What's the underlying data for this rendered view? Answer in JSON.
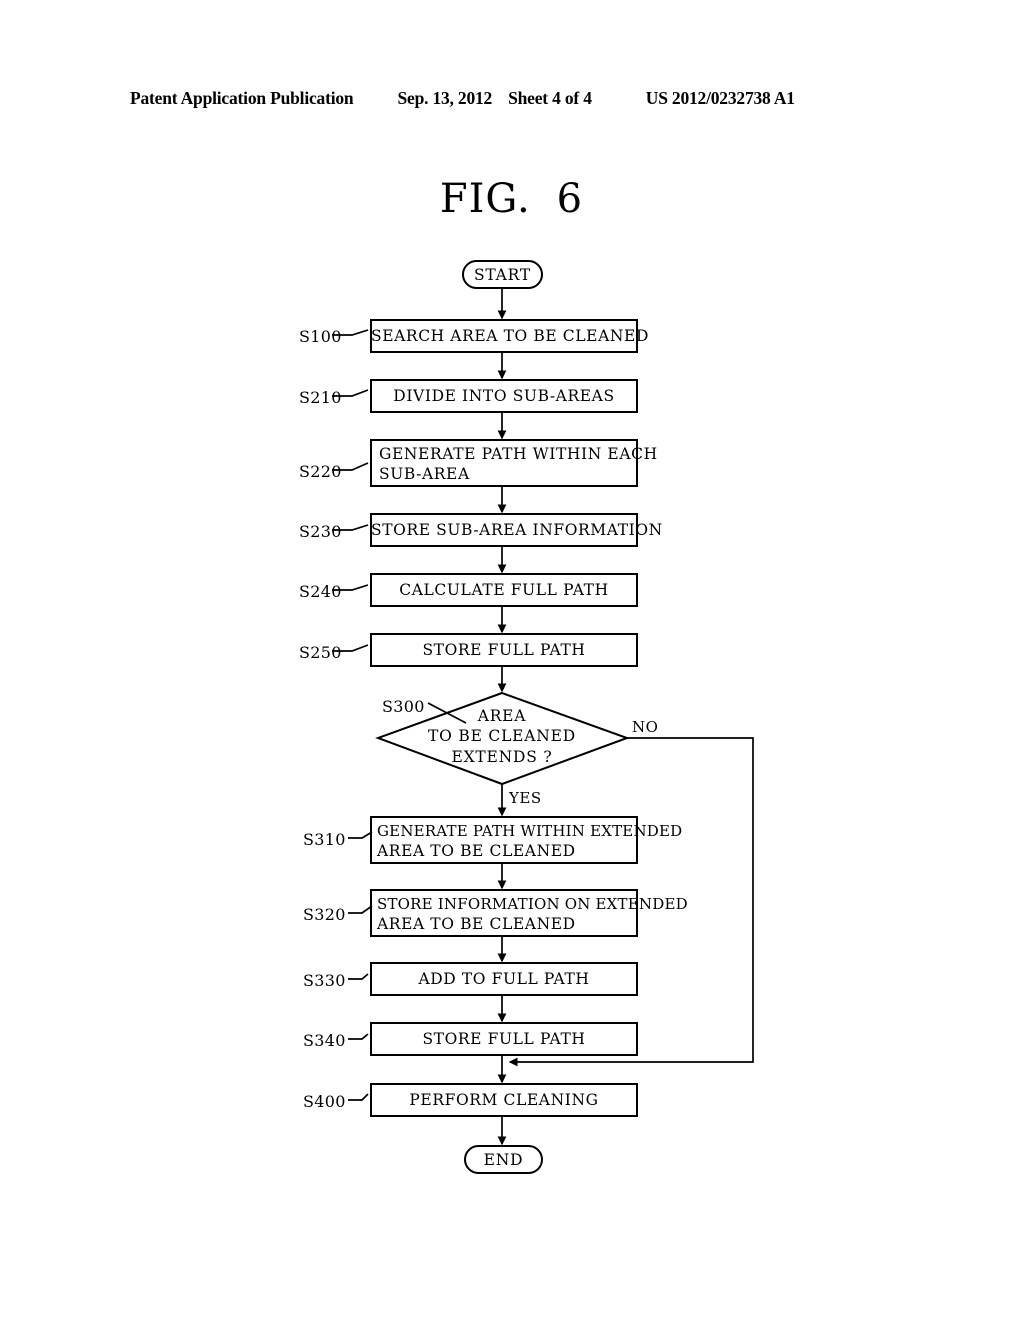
{
  "header": {
    "publication": "Patent Application Publication",
    "date": "Sep. 13, 2012",
    "sheet": "Sheet 4 of 4",
    "document_number": "US 2012/0232738 A1"
  },
  "figure": {
    "label": "FIG.",
    "number": "6"
  },
  "colors": {
    "ink": "#000000",
    "page": "#ffffff"
  },
  "flowchart": {
    "start_label": "START",
    "end_label": "END",
    "branch_yes": "YES",
    "branch_no": "NO",
    "decision": {
      "ref": "S300",
      "line1": "AREA",
      "line2": "TO BE CLEANED",
      "line3": "EXTENDS ?"
    },
    "steps": [
      {
        "ref": "S100",
        "line1": "SEARCH AREA TO BE CLEANED",
        "line2": "",
        "align": "center"
      },
      {
        "ref": "S210",
        "line1": "DIVIDE INTO SUB-AREAS",
        "line2": "",
        "align": "center"
      },
      {
        "ref": "S220",
        "line1": "GENERATE PATH WITHIN EACH",
        "line2": "SUB-AREA",
        "align": "left"
      },
      {
        "ref": "S230",
        "line1": "STORE SUB-AREA INFORMATION",
        "line2": "",
        "align": "center"
      },
      {
        "ref": "S240",
        "line1": "CALCULATE FULL PATH",
        "line2": "",
        "align": "center"
      },
      {
        "ref": "S250",
        "line1": "STORE FULL PATH",
        "line2": "",
        "align": "center"
      },
      {
        "ref": "S310",
        "line1": "GENERATE PATH WITHIN EXTENDED",
        "line2": "AREA TO BE CLEANED",
        "align": "left"
      },
      {
        "ref": "S320",
        "line1": "STORE INFORMATION ON EXTENDED",
        "line2": "AREA TO BE CLEANED",
        "align": "left"
      },
      {
        "ref": "S330",
        "line1": "ADD TO FULL PATH",
        "line2": "",
        "align": "center"
      },
      {
        "ref": "S340",
        "line1": "STORE FULL PATH",
        "line2": "",
        "align": "center"
      },
      {
        "ref": "S400",
        "line1": "PERFORM CLEANING",
        "line2": "",
        "align": "center"
      }
    ]
  }
}
